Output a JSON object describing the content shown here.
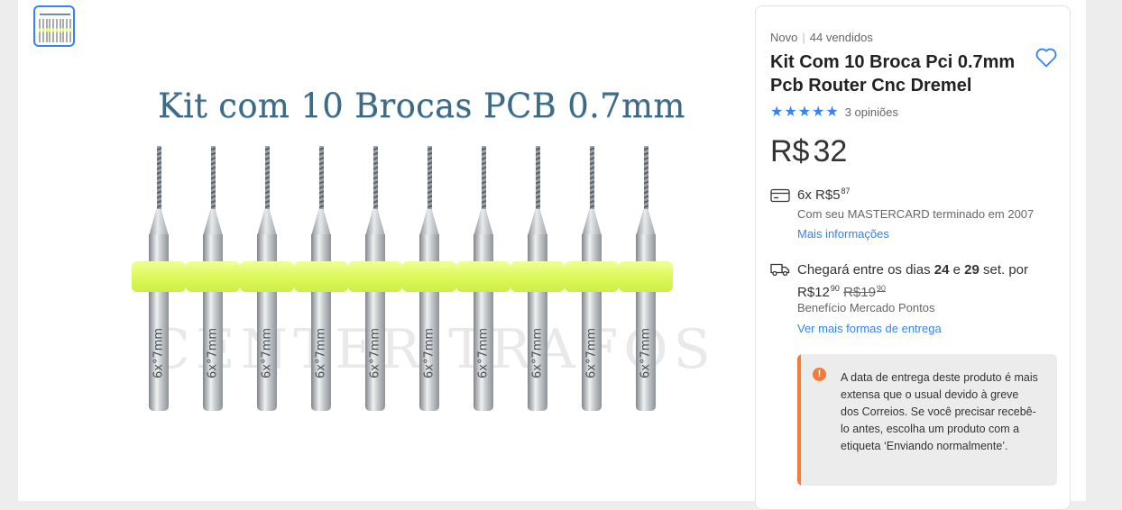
{
  "gallery": {
    "image_text": "Kit com 10 Brocas PCB 0.7mm",
    "watermark": "CENTER TRAFOS",
    "drill_label": "6x°7mm",
    "drill_count": 10
  },
  "product": {
    "condition": "Novo",
    "sold": "44 vendidos",
    "title": "Kit Com 10 Broca Pci 0.7mm Pcb Router Cnc Dremel",
    "stars": "★★★★★",
    "reviews": "3 opiniões",
    "currency": "R$",
    "price": "32"
  },
  "installments": {
    "prefix": "6x R$",
    "amount": "5",
    "cents": "87",
    "card_text": "Com seu MASTERCARD terminado em 2007",
    "more_link": "Mais informações"
  },
  "shipping": {
    "text_1": "Chegará entre os dias ",
    "day_1": "24",
    "text_2": " e ",
    "day_2": "29",
    "text_3": " set. por",
    "price_prefix": "R$",
    "price": "12",
    "price_cents": "90",
    "old_price": "R$19",
    "old_cents": "90",
    "benefit": "Benefício Mercado Pontos",
    "more_link": "Ver mais formas de entrega"
  },
  "notice": {
    "icon": "!",
    "text": "A data de entrega deste produto é mais extensa que o usual devido à greve dos Correios. Se você precisar recebê-lo antes, escolha um produto com a etiqueta ‘Enviando normalmente’."
  },
  "colors": {
    "accent": "#3483fa",
    "warning": "#f5793b",
    "ring": "#dcf95a"
  }
}
